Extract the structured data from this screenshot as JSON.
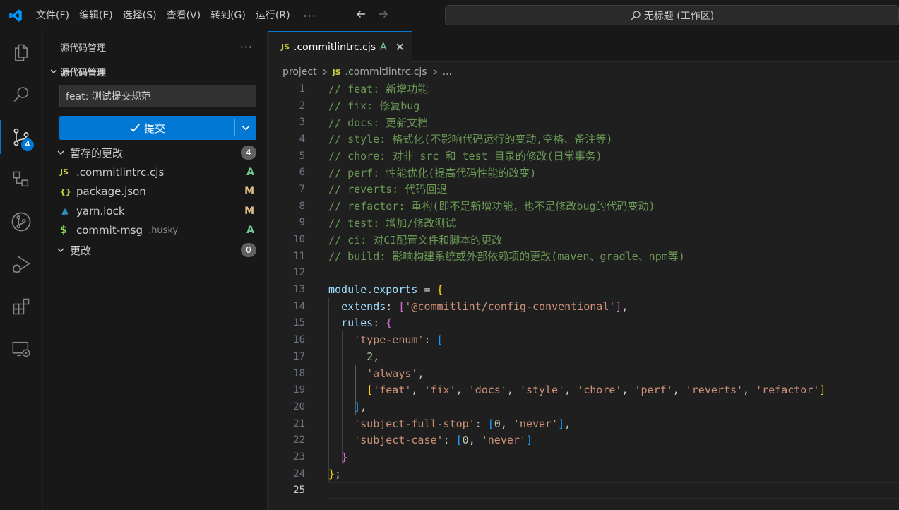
{
  "titlebar": {
    "menu": [
      "文件(F)",
      "编辑(E)",
      "选择(S)",
      "查看(V)",
      "转到(G)",
      "运行(R)"
    ],
    "more": "···",
    "search_text": "无标题 (工作区)"
  },
  "activitybar": {
    "items": [
      "explorer-icon",
      "search-icon",
      "source-control-icon",
      "remote-explorer-icon",
      "git-graph-icon",
      "run-debug-icon",
      "extensions-icon",
      "remote-window-icon"
    ],
    "scm_badge": "4"
  },
  "sidebar": {
    "title": "源代码管理",
    "more": "···",
    "section_title": "源代码管理",
    "commit_message": "feat: 测试提交规范",
    "commit_label": "提交",
    "staged": {
      "label": "暂存的更改",
      "count": "4",
      "files": [
        {
          "icon": "JS",
          "name": ".commitlintrc.cjs",
          "dir": "",
          "status": "A"
        },
        {
          "icon": "{}",
          "name": "package.json",
          "dir": "",
          "status": "M"
        },
        {
          "icon": "yarn",
          "name": "yarn.lock",
          "dir": "",
          "status": "M"
        },
        {
          "icon": "$",
          "name": "commit-msg",
          "dir": ".husky",
          "status": "A"
        }
      ]
    },
    "changes": {
      "label": "更改",
      "count": "0"
    }
  },
  "editor": {
    "tab": {
      "icon": "JS",
      "name": ".commitlintrc.cjs",
      "status": "A",
      "close": "✕"
    },
    "breadcrumb": {
      "folder": "project",
      "file_icon": "JS",
      "file": ".commitlintrc.cjs",
      "more": "..."
    },
    "current_line": 25,
    "lines": [
      "// feat: 新增功能",
      "// fix: 修复bug",
      "// docs: 更新文档",
      "// style: 格式化(不影响代码运行的变动,空格、备注等)",
      "// chore: 对非 src 和 test 目录的修改(日常事务)",
      "// perf: 性能优化(提高代码性能的改变)",
      "// reverts: 代码回退",
      "// refactor: 重构(即不是新增功能，也不是修改bug的代码变动)",
      "// test: 增加/修改测试",
      "// ci: 对CI配置文件和脚本的更改",
      "// build: 影响构建系统或外部依赖项的更改(maven、gradle、npm等)",
      "",
      "module.exports = {",
      "  extends: ['@commitlint/config-conventional'],",
      "  rules: {",
      "    'type-enum': [",
      "      2,",
      "      'always',",
      "      ['feat', 'fix', 'docs', 'style', 'chore', 'perf', 'reverts', 'refactor']",
      "    ],",
      "    'subject-full-stop': [0, 'never'],",
      "    'subject-case': [0, 'never']",
      "  }",
      "};",
      ""
    ]
  }
}
